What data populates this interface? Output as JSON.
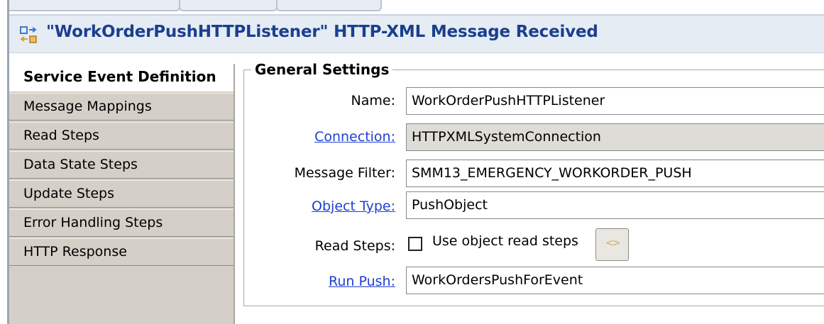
{
  "header": {
    "title": "\"WorkOrderPushHTTPListener\" HTTP-XML Message Received",
    "icon": "listener-icon"
  },
  "nav": {
    "items": [
      {
        "label": "Service Event Definition",
        "active": true
      },
      {
        "label": "Message Mappings",
        "active": false
      },
      {
        "label": "Read Steps",
        "active": false
      },
      {
        "label": "Data State Steps",
        "active": false
      },
      {
        "label": "Update Steps",
        "active": false
      },
      {
        "label": "Error Handling Steps",
        "active": false
      },
      {
        "label": "HTTP Response",
        "active": false
      }
    ]
  },
  "general": {
    "legend": "General Settings",
    "name_label": "Name:",
    "name_value": "WorkOrderPushHTTPListener",
    "connection_label": "Connection:",
    "connection_value": "HTTPXMLSystemConnection",
    "filter_label": "Message Filter:",
    "filter_value": "SMM13_EMERGENCY_WORKORDER_PUSH",
    "object_type_label": "Object Type:",
    "object_type_value": "PushObject",
    "read_steps_label": "Read Steps:",
    "read_steps_checkbox_label": "Use object read steps",
    "read_steps_checked": false,
    "run_push_label": "Run Push:",
    "run_push_value": "WorkOrdersPushForEvent"
  },
  "colors": {
    "title": "#1a3f8f",
    "link": "#1f3fd0",
    "nav_bg": "#d4d0c8",
    "header_bg": "#e6ecf3"
  }
}
